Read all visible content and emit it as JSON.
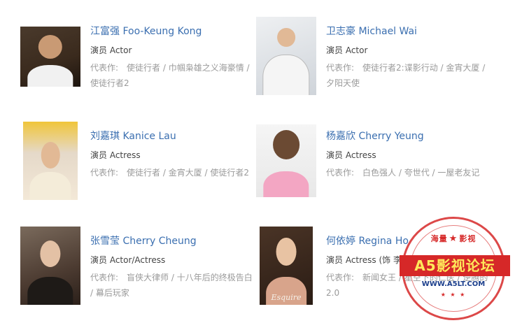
{
  "cast": [
    {
      "name": "江富强 Foo-Keung Kong",
      "role": "演员 Actor",
      "works_label": "代表作:",
      "works": "使徒行者 / 巾帼枭雄之义海豪情 / 使徒行者2"
    },
    {
      "name": "卫志豪 Michael Wai",
      "role": "演员 Actor",
      "works_label": "代表作:",
      "works": "使徒行者2:谍影行动 / 金宵大厦 / 夕阳天使"
    },
    {
      "name": "刘嘉琪 Kanice Lau",
      "role": "演员 Actress",
      "works_label": "代表作:",
      "works": "使徒行者 / 金宵大厦 / 使徒行者2"
    },
    {
      "name": "杨嘉欣 Cherry Yeung",
      "role": "演员 Actress",
      "works_label": "代表作:",
      "works": "白色强人 / 夸世代 / 一屋老友记"
    },
    {
      "name": "张雪莹 Cherry Cheung",
      "role": "演员 Actor/Actress",
      "works_label": "代表作:",
      "works": "盲侠大律师 / 十八年后的终极告白 / 幕后玩家"
    },
    {
      "name": "何依婷 Regina Ho",
      "role": "演员 Actress (饰 李军安)",
      "works_label": "代表作:",
      "works": "新闻女王 / 星空下的仁医 / 逆腾的2.0",
      "photo_caption": "Esquire"
    }
  ],
  "watermark": {
    "top_text_left": "海量",
    "top_text_right": "影视",
    "banner": "A5影视论坛",
    "url": "WWW.A5LT.COM",
    "star": "★",
    "mini_stars": "★ ★ ★"
  },
  "colors": {
    "name_link": "#3b6fb0",
    "stamp_red": "#d62828",
    "stamp_yellow": "#ffe95a"
  }
}
